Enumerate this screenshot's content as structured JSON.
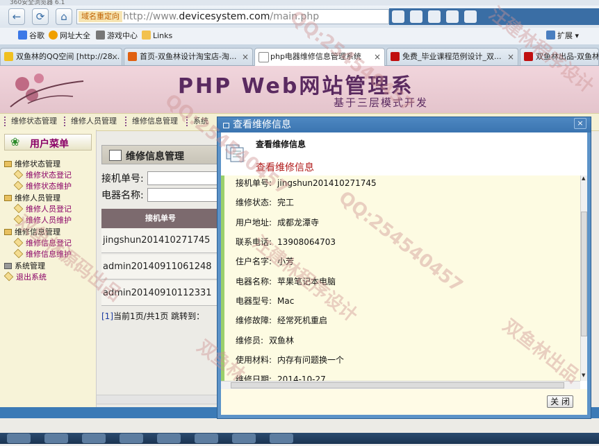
{
  "browser": {
    "title_strip": "360安全浏览器 6.1",
    "address_badge": "域名重定向",
    "url_prefix": "http://www.",
    "url_domain": "devicesystem.com",
    "url_path": "/main.php"
  },
  "bookmarks": [
    {
      "label": "谷歌"
    },
    {
      "label": "网址大全"
    },
    {
      "label": "游戏中心"
    },
    {
      "label": "Links"
    }
  ],
  "bookmarks_extend": "扩展",
  "tabs": [
    {
      "label": "双鱼林的QQ空间 [http://28...",
      "close": "×"
    },
    {
      "label": "首页-双鱼林设计淘宝店-淘...",
      "close": "×"
    },
    {
      "label": "php电器维修信息管理系统",
      "close": "×"
    },
    {
      "label": "免费_毕业课程范例设计_双...",
      "close": "×"
    },
    {
      "label": "双鱼林出品-双鱼林",
      "close": ""
    }
  ],
  "site": {
    "banner_title": "PHP Web网站管理系",
    "banner_sub": "基于三层模式开发",
    "topnav": [
      "维修状态管理",
      "维修人员管理",
      "维修信息管理",
      "系统"
    ],
    "menu_title": "用户菜单",
    "menu": [
      {
        "label": "维修状态管理",
        "type": "group"
      },
      {
        "label": "维修状态登记",
        "type": "sub"
      },
      {
        "label": "维修状态维护",
        "type": "sub"
      },
      {
        "label": "维修人员管理",
        "type": "group"
      },
      {
        "label": "维修人员登记",
        "type": "sub"
      },
      {
        "label": "维修人员维护",
        "type": "sub"
      },
      {
        "label": "维修信息管理",
        "type": "group"
      },
      {
        "label": "维修信息登记",
        "type": "sub"
      },
      {
        "label": "维修信息维护",
        "type": "sub"
      },
      {
        "label": "系统管理",
        "type": "group"
      },
      {
        "label": "退出系统",
        "type": "sub"
      }
    ],
    "main_title": "维修信息管理",
    "filter_labels": [
      "接机单号:",
      "电器名称:"
    ],
    "table_header": "接机单号",
    "rows": [
      "jingshun201410271745",
      "admin20140911061248",
      "admin20140910112331"
    ],
    "pager_link": "[1]",
    "pager_text": "当前1页/共1页 跳转到："
  },
  "dialog": {
    "title": "查看维修信息",
    "close_x": "×",
    "header_title": "查看维修信息",
    "header_subtitle": "查看维修信息",
    "fields": [
      {
        "label": "接机单号:",
        "value": "jingshun201410271745"
      },
      {
        "label": "维修状态:",
        "value": "完工"
      },
      {
        "label": "用户地址:",
        "value": "成都龙潭寺"
      },
      {
        "label": "联系电话:",
        "value": "13908064703"
      },
      {
        "label": "住户名字:",
        "value": "小芳"
      },
      {
        "label": "电器名称:",
        "value": "苹果笔记本电脑"
      },
      {
        "label": "电器型号:",
        "value": "Mac"
      },
      {
        "label": "维修故障:",
        "value": "经常死机重启"
      },
      {
        "label": "维修员:",
        "value": "双鱼林"
      },
      {
        "label": "使用材料:",
        "value": "内存有问题换一个"
      },
      {
        "label": "维修日期:",
        "value": "2014-10-27"
      }
    ],
    "close_button": "关 闭"
  },
  "watermark": {
    "lines": [
      "QQ:254540457",
      "汪建林程序设计",
      "双鱼林源码出品",
      "QQ:254540457",
      "汪建林程序设计",
      "双鱼林出品",
      "QQ:254540457",
      "双鱼林"
    ]
  }
}
